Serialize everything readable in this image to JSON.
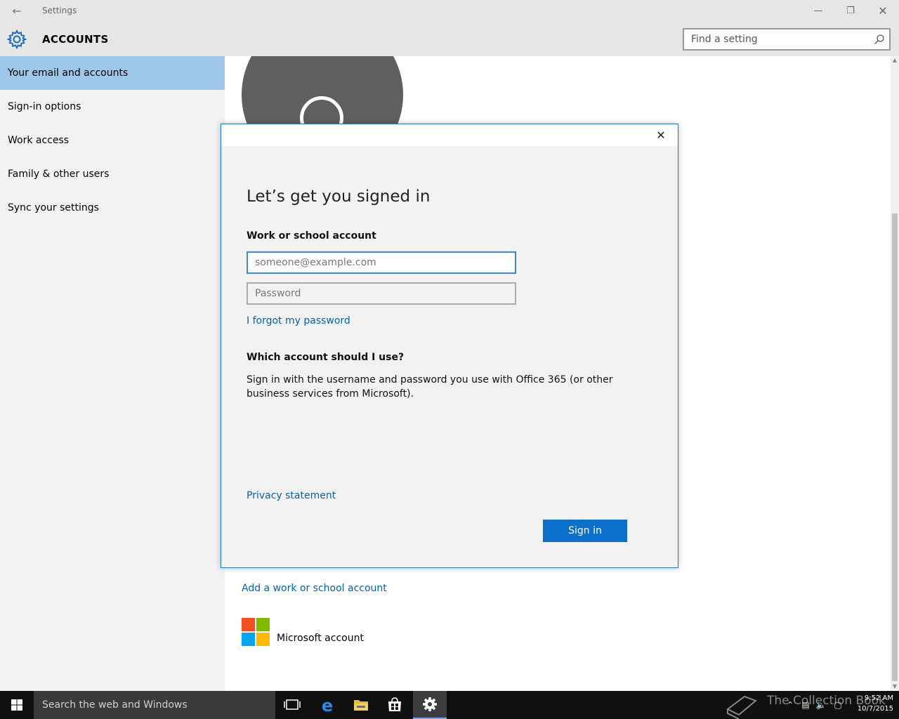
{
  "window": {
    "title": "Settings",
    "back_icon": "back-arrow-icon"
  },
  "header": {
    "title": "ACCOUNTS",
    "search_placeholder": "Find a setting"
  },
  "sidebar": {
    "items": [
      {
        "label": "Your email and accounts",
        "active": true
      },
      {
        "label": "Sign-in options"
      },
      {
        "label": "Work access"
      },
      {
        "label": "Family & other users"
      },
      {
        "label": "Sync your settings"
      }
    ]
  },
  "content": {
    "add_account_link": "Add a work or school account",
    "microsoft_account_label": "Microsoft account"
  },
  "dialog": {
    "heading": "Let’s get you signed in",
    "account_label": "Work or school account",
    "email_placeholder": "someone@example.com",
    "password_placeholder": "Password",
    "forgot_link": "I forgot my password",
    "which_heading": "Which account should I use?",
    "which_body": "Sign in with the username and password you use with Office 365 (or other business services from Microsoft).",
    "privacy_link": "Privacy statement",
    "signin_button": "Sign in"
  },
  "taskbar": {
    "search_placeholder": "Search the web and Windows",
    "watermark": "The Collection Book",
    "time": "9:52 AM",
    "date": "10/7/2015"
  },
  "colors": {
    "accent": "#0063b1",
    "active_nav": "#9fc7ea",
    "dialog_border": "#1979ca",
    "signin_button": "#0a70cc"
  }
}
